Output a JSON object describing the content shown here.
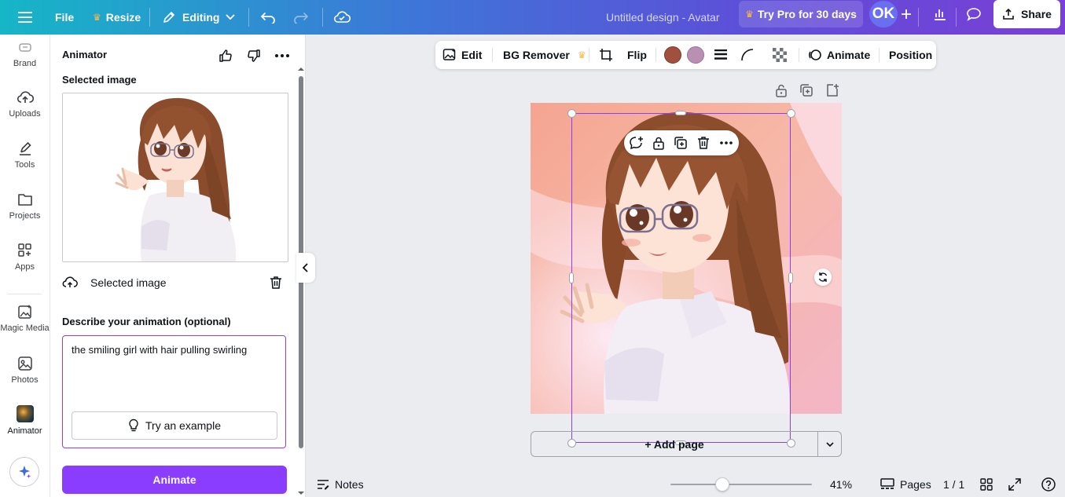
{
  "topbar": {
    "file_label": "File",
    "resize_label": "Resize",
    "editing_label": "Editing",
    "doc_title": "Untitled design - Avatar",
    "pro_label": "Try Pro for 30 days",
    "avatar_initials": "OK",
    "share_label": "Share"
  },
  "rail": {
    "items": [
      {
        "label": "Brand",
        "icon": "brand-icon"
      },
      {
        "label": "Uploads",
        "icon": "upload-cloud-icon"
      },
      {
        "label": "Tools",
        "icon": "pen-icon"
      },
      {
        "label": "Projects",
        "icon": "folder-icon"
      },
      {
        "label": "Apps",
        "icon": "apps-grid-icon"
      },
      {
        "label": "Magic Media",
        "icon": "magic-media-icon"
      },
      {
        "label": "Photos",
        "icon": "photo-icon"
      },
      {
        "label": "Animator",
        "icon": "animator-app-icon"
      }
    ]
  },
  "panel": {
    "title": "Animator",
    "selected_image_heading": "Selected image",
    "selected_image_label": "Selected image",
    "describe_label": "Describe your animation (optional)",
    "describe_value": "the smiling girl with hair pulling swirling",
    "example_label": "Try an example",
    "animate_label": "Animate"
  },
  "context_toolbar": {
    "edit_label": "Edit",
    "bg_remover_label": "BG Remover",
    "flip_label": "Flip",
    "animate_label": "Animate",
    "position_label": "Position",
    "swatch_colors": [
      "#a0503d",
      "#b98fb4"
    ]
  },
  "canvas": {
    "add_page_label": "+ Add page"
  },
  "bottombar": {
    "notes_label": "Notes",
    "zoom_value": "41%",
    "zoom_fraction": 0.41,
    "pages_label": "Pages",
    "page_counter": "1 / 1"
  },
  "colors": {
    "accent": "#8b3dff",
    "gradient_start": "#16b6c7",
    "gradient_end": "#7a3fd6"
  }
}
